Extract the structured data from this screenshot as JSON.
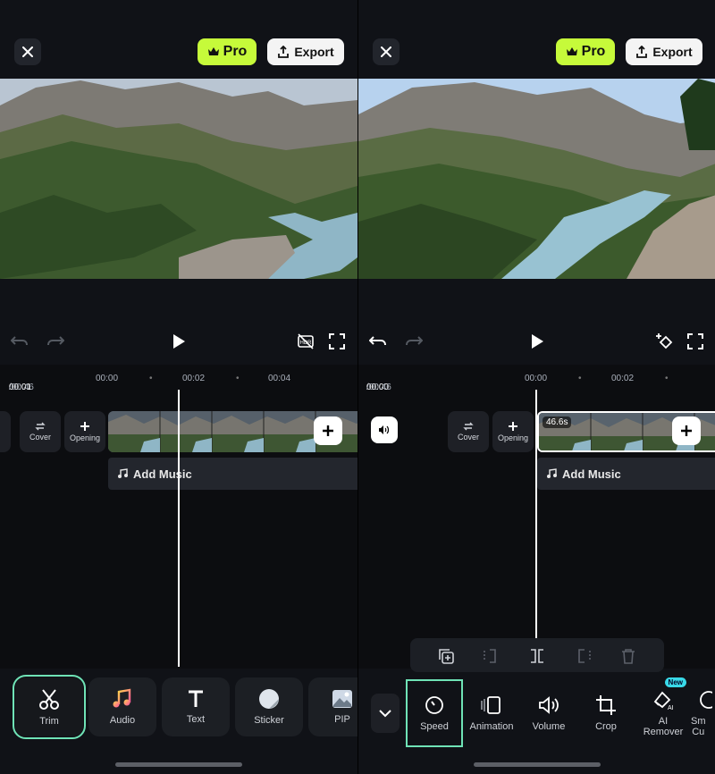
{
  "left": {
    "topbar": {
      "pro_label": "Pro",
      "export_label": "Export"
    },
    "timeline": {
      "current_time": "00:01",
      "total_time": "/00:46",
      "ticks": [
        "00:00",
        "00:02",
        "00:04"
      ],
      "cover_label": "Cover",
      "opening_label": "Opening",
      "add_music_label": "Add Music"
    },
    "tools": [
      {
        "label": "Trim",
        "icon": "scissors-icon"
      },
      {
        "label": "Audio",
        "icon": "music-note-icon"
      },
      {
        "label": "Text",
        "icon": "text-icon"
      },
      {
        "label": "Sticker",
        "icon": "sticker-icon"
      },
      {
        "label": "PIP",
        "icon": "image-icon"
      }
    ]
  },
  "right": {
    "topbar": {
      "pro_label": "Pro",
      "export_label": "Export"
    },
    "timeline": {
      "current_time": "00:00",
      "total_time": "/00:46",
      "ticks": [
        "00:00",
        "00:02"
      ],
      "cover_label": "Cover",
      "opening_label": "Opening",
      "clip_duration": "46.6s",
      "add_music_label": "Add Music"
    },
    "edit_tools": [
      {
        "label": "Speed",
        "icon": "speed-icon"
      },
      {
        "label": "Animation",
        "icon": "animation-icon"
      },
      {
        "label": "Volume",
        "icon": "volume-icon"
      },
      {
        "label": "Crop",
        "icon": "crop-icon"
      },
      {
        "label": "AI\nRemover",
        "icon": "ai-remover-icon",
        "badge": "New"
      },
      {
        "label": "Sm\nCu",
        "icon": "smart-cut-icon"
      }
    ]
  },
  "colors": {
    "accent_pro": "#c6fa3a",
    "selection": "#6fe3b6",
    "badge": "#39d9e8"
  }
}
